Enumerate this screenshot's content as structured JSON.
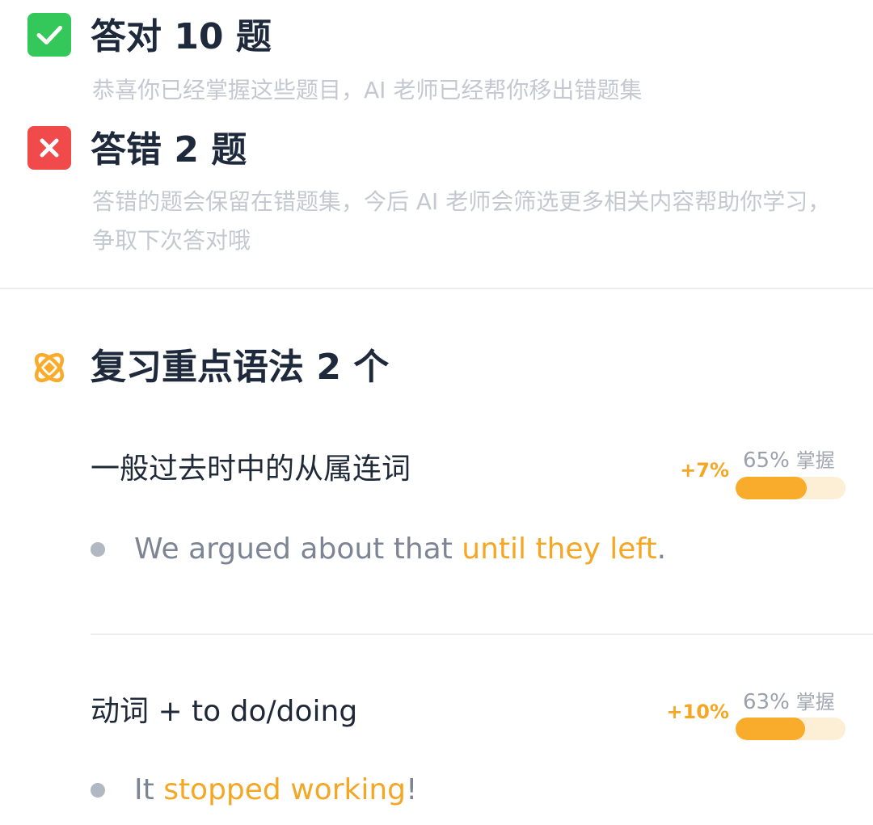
{
  "results": {
    "correct": {
      "title": "答对 10 题",
      "description": "恭喜你已经掌握这些题目，AI 老师已经帮你移出错题集",
      "color": "#34c759"
    },
    "wrong": {
      "title": "答错 2 题",
      "description": "答错的题会保留在错题集，今后 AI 老师会筛选更多相关内容帮助你学习，争取下次答对哦",
      "color": "#f04a4a"
    }
  },
  "review": {
    "title": "复习重点语法 2 个",
    "icon": "knot-icon",
    "accent_color": "#f9ab2c",
    "items": [
      {
        "title": "一般过去时中的从属连词",
        "delta": "+7%",
        "percent_text": "65%",
        "mastery_label": "掌握",
        "mastery": 0.65,
        "example": {
          "before": "We argued about that ",
          "highlight": "until they left",
          "after": "."
        }
      },
      {
        "title": "动词 + to do/doing",
        "delta": "+10%",
        "percent_text": "63%",
        "mastery_label": "掌握",
        "mastery": 0.63,
        "example": {
          "before": "It ",
          "highlight": "stopped working",
          "after": "!"
        }
      }
    ]
  }
}
